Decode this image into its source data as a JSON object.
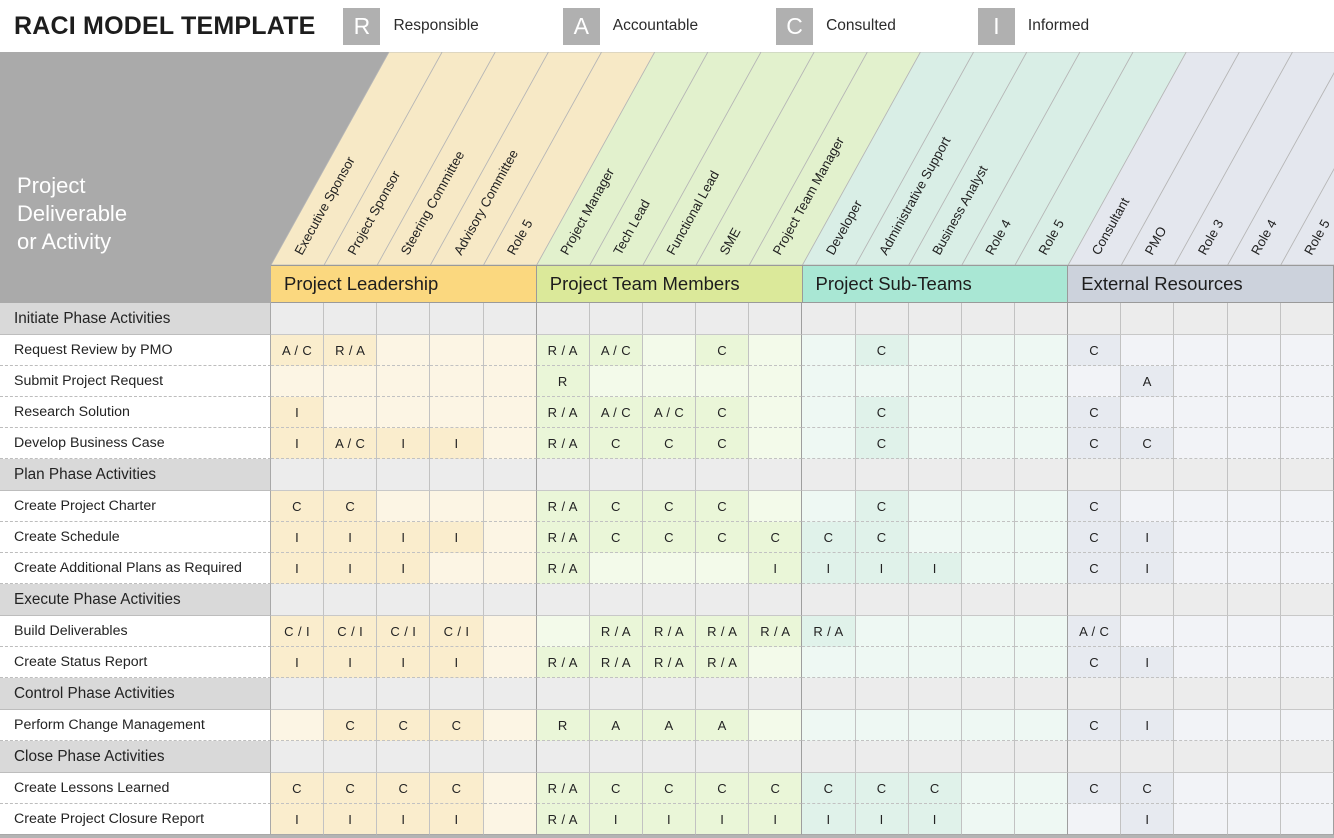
{
  "header": {
    "title": "RACI MODEL TEMPLATE",
    "legend": [
      {
        "key": "R",
        "label": "Responsible"
      },
      {
        "key": "A",
        "label": "Accountable"
      },
      {
        "key": "C",
        "label": "Consulted"
      },
      {
        "key": "I",
        "label": "Informed"
      }
    ]
  },
  "corner": {
    "line1": "Project",
    "line2": "Deliverable",
    "line3": "or Activity"
  },
  "colors": {
    "chip": "#b0b0b0",
    "corner_bg": "#aaaaaa",
    "group_leadership": "#fbd87f",
    "group_team": "#dbe99a",
    "group_subteams": "#a9e7d4",
    "group_external": "#ccd2dc",
    "col_leadership": "#faedcd",
    "col_team": "#e4f2d0",
    "col_subteams": "#dbf0e8",
    "col_external": "#e7eaf0",
    "section_row": "#d9d9d9"
  },
  "groups": [
    {
      "name": "Project Leadership",
      "band_color": "#fbd87f",
      "cell_color": "#faedcd",
      "head_color": "#f7e9c6",
      "columns": [
        "Executive Sponsor",
        "Project Sponsor",
        "Steering Committee",
        "Advisory Committee",
        "Role 5"
      ]
    },
    {
      "name": "Project Team Members",
      "band_color": "#dbe99a",
      "cell_color": "#eaf6d8",
      "head_color": "#e2f1cd",
      "columns": [
        "Project Manager",
        "Tech Lead",
        "Functional Lead",
        "SME",
        "Project Team Manager"
      ]
    },
    {
      "name": "Project Sub-Teams",
      "band_color": "#a9e7d4",
      "cell_color": "#e0f2ea",
      "head_color": "#d9eee6",
      "columns": [
        "Developer",
        "Administrative Support",
        "Business Analyst",
        "Role 4",
        "Role 5"
      ]
    },
    {
      "name": "External Resources",
      "band_color": "#ccd2dc",
      "cell_color": "#e7eaf0",
      "head_color": "#e4e7ee",
      "columns": [
        "Consultant",
        "PMO",
        "Role 3",
        "Role 4",
        "Role 5"
      ]
    }
  ],
  "rows": [
    {
      "type": "section",
      "label": "Initiate Phase Activities",
      "values": []
    },
    {
      "type": "item",
      "label": "Request Review by PMO",
      "values": [
        "A / C",
        "R / A",
        "",
        "",
        "",
        "R / A",
        "A / C",
        "",
        "C",
        "",
        "",
        "C",
        "",
        "",
        "",
        "C",
        "",
        "",
        "",
        ""
      ]
    },
    {
      "type": "item",
      "label": "Submit Project Request",
      "values": [
        "",
        "",
        "",
        "",
        "",
        "R",
        "",
        "",
        "",
        "",
        "",
        "",
        "",
        "",
        "",
        "",
        "A",
        "",
        "",
        ""
      ]
    },
    {
      "type": "item",
      "label": "Research Solution",
      "values": [
        "I",
        "",
        "",
        "",
        "",
        "R / A",
        "A / C",
        "A / C",
        "C",
        "",
        "",
        "C",
        "",
        "",
        "",
        "C",
        "",
        "",
        "",
        ""
      ]
    },
    {
      "type": "item",
      "label": "Develop Business Case",
      "values": [
        "I",
        "A / C",
        "I",
        "I",
        "",
        "R / A",
        "C",
        "C",
        "C",
        "",
        "",
        "C",
        "",
        "",
        "",
        "C",
        "C",
        "",
        "",
        ""
      ]
    },
    {
      "type": "section",
      "label": "Plan Phase Activities",
      "values": []
    },
    {
      "type": "item",
      "label": "Create Project Charter",
      "values": [
        "C",
        "C",
        "",
        "",
        "",
        "R / A",
        "C",
        "C",
        "C",
        "",
        "",
        "C",
        "",
        "",
        "",
        "C",
        "",
        "",
        "",
        ""
      ]
    },
    {
      "type": "item",
      "label": "Create Schedule",
      "values": [
        "I",
        "I",
        "I",
        "I",
        "",
        "R / A",
        "C",
        "C",
        "C",
        "C",
        "C",
        "C",
        "",
        "",
        "",
        "C",
        "I",
        "",
        "",
        ""
      ]
    },
    {
      "type": "item",
      "label": "Create Additional Plans as Required",
      "values": [
        "I",
        "I",
        "I",
        "",
        "",
        "R / A",
        "",
        "",
        "",
        "I",
        "I",
        "I",
        "I",
        "",
        "",
        "C",
        "I",
        "",
        "",
        ""
      ]
    },
    {
      "type": "section",
      "label": "Execute Phase Activities",
      "values": []
    },
    {
      "type": "item",
      "label": "Build Deliverables",
      "values": [
        "C / I",
        "C / I",
        "C / I",
        "C / I",
        "",
        "",
        "R / A",
        "R / A",
        "R / A",
        "R / A",
        "R / A",
        "",
        "",
        "",
        "",
        "A / C",
        "",
        "",
        "",
        ""
      ]
    },
    {
      "type": "item",
      "label": "Create Status Report",
      "values": [
        "I",
        "I",
        "I",
        "I",
        "",
        "R / A",
        "R / A",
        "R / A",
        "R / A",
        "",
        "",
        "",
        "",
        "",
        "",
        "C",
        "I",
        "",
        "",
        ""
      ]
    },
    {
      "type": "section",
      "label": "Control Phase Activities",
      "values": []
    },
    {
      "type": "item",
      "label": "Perform Change Management",
      "values": [
        "",
        "C",
        "C",
        "C",
        "",
        "R",
        "A",
        "A",
        "A",
        "",
        "",
        "",
        "",
        "",
        "",
        "C",
        "I",
        "",
        "",
        ""
      ]
    },
    {
      "type": "section",
      "label": "Close Phase Activities",
      "values": []
    },
    {
      "type": "item",
      "label": "Create Lessons Learned",
      "values": [
        "C",
        "C",
        "C",
        "C",
        "",
        "R / A",
        "C",
        "C",
        "C",
        "C",
        "C",
        "C",
        "C",
        "",
        "",
        "C",
        "C",
        "",
        "",
        ""
      ]
    },
    {
      "type": "item",
      "label": "Create Project Closure Report",
      "values": [
        "I",
        "I",
        "I",
        "I",
        "",
        "R / A",
        "I",
        "I",
        "I",
        "I",
        "I",
        "I",
        "I",
        "",
        "",
        "",
        "I",
        "",
        "",
        ""
      ]
    }
  ]
}
